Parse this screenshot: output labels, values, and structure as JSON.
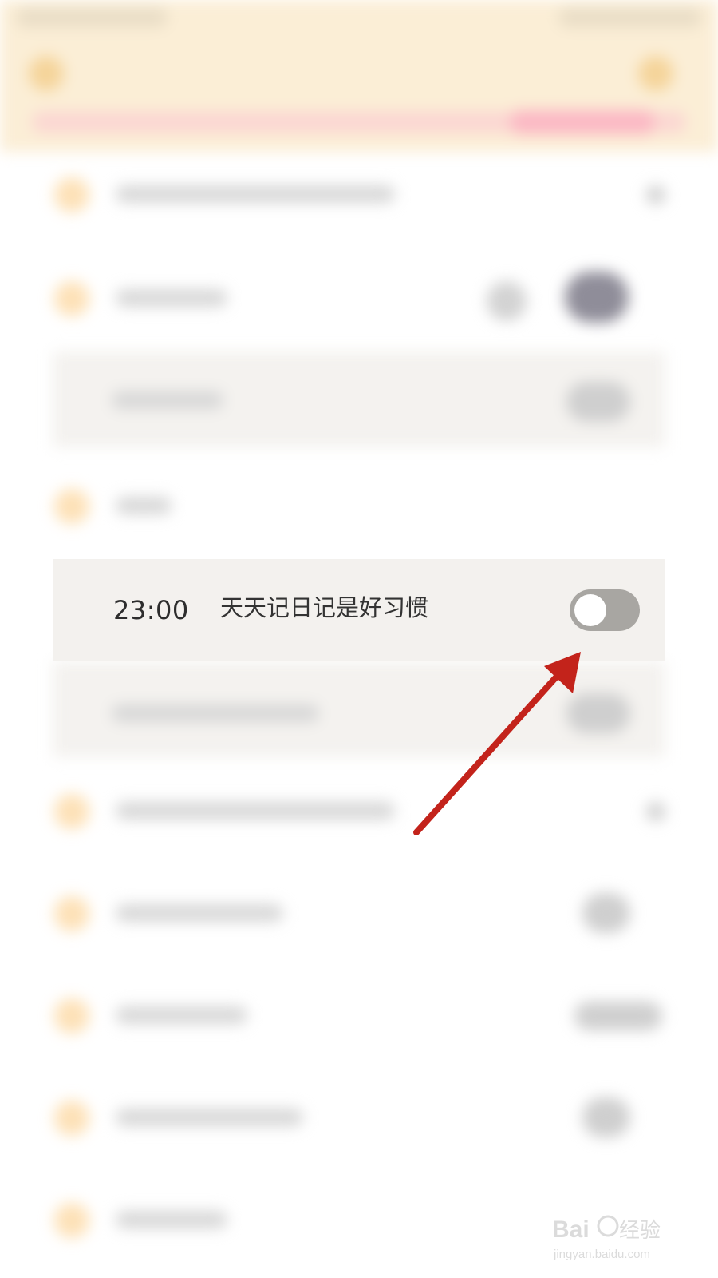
{
  "reminder": {
    "time": "23:00",
    "text": "天天记日记是好习惯",
    "enabled": false
  },
  "annotation": {
    "arrow_color": "#c3231b"
  },
  "watermark": {
    "brand": "Baidu经验",
    "url": "jingyan.baidu.com"
  },
  "colors": {
    "header_bg": "#fbeed6",
    "accent_dot": "#fde1b7",
    "toggle_off": "#a8a6a2"
  }
}
